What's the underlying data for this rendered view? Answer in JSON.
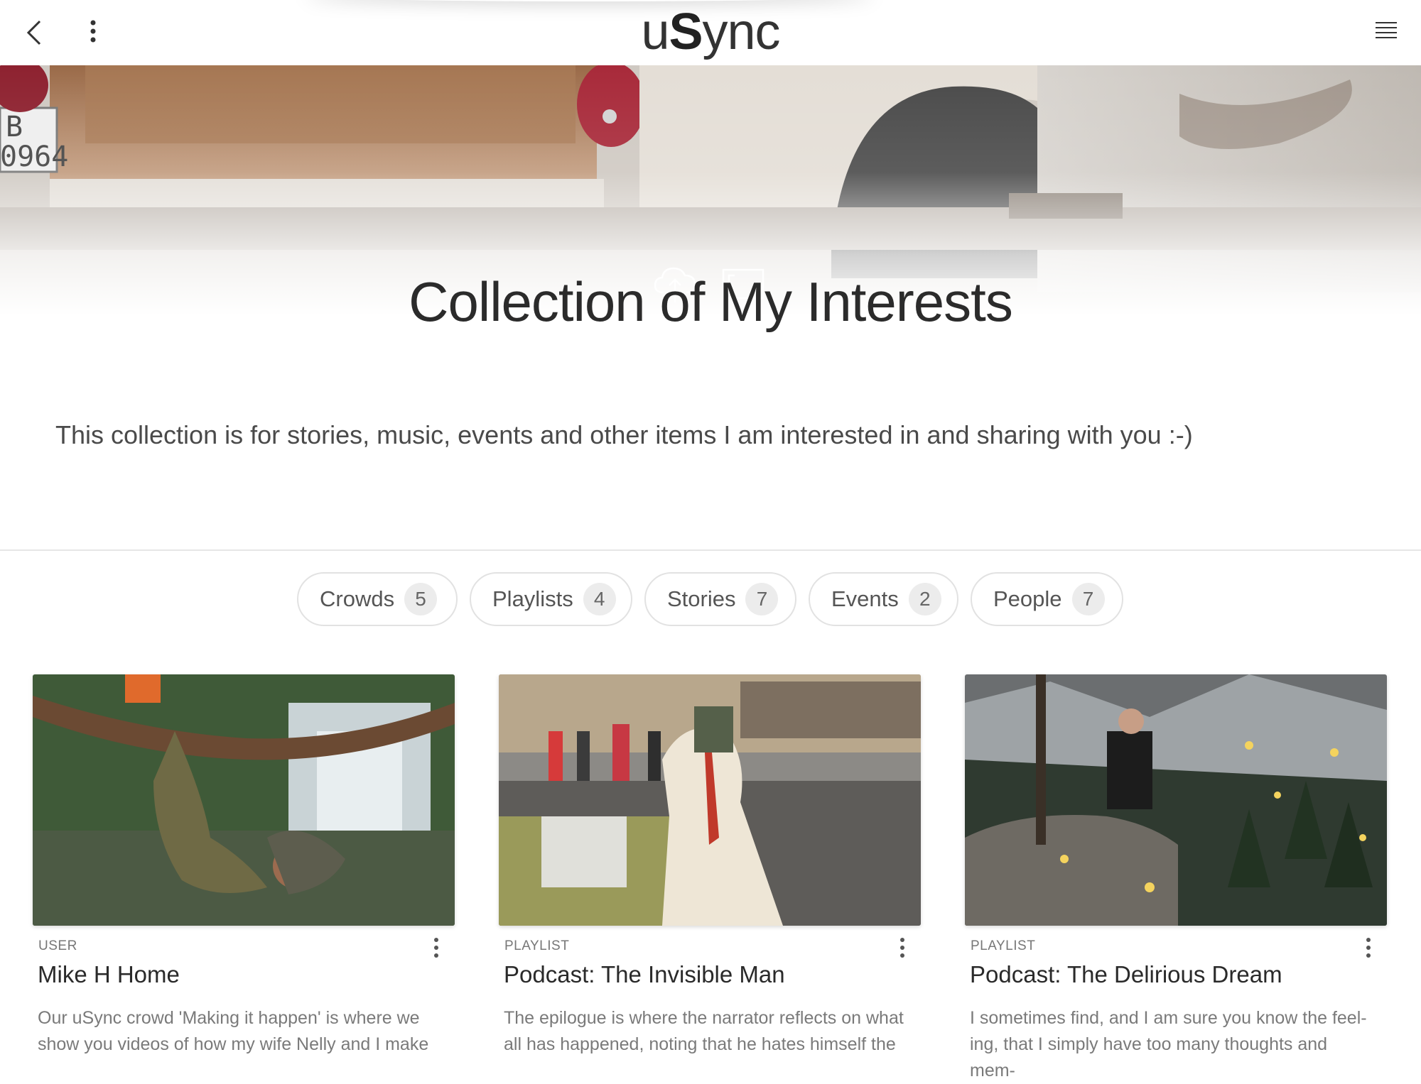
{
  "app": {
    "logo_prefix": "u",
    "logo_bold": "S",
    "logo_suffix": "ync"
  },
  "header_icons": [
    "back-arrow-icon",
    "more-vertical-icon",
    "hamburger-menu-icon"
  ],
  "hero": {
    "title": "Collection of My Interests",
    "icons": [
      "upload-cloud-icon",
      "fullscreen-icon"
    ]
  },
  "description": "This collection is for stories, music, events and other items I am interested in and sharing with you :-)",
  "filters": [
    {
      "label": "Crowds",
      "count": "5"
    },
    {
      "label": "Playlists",
      "count": "4"
    },
    {
      "label": "Stories",
      "count": "7"
    },
    {
      "label": "Events",
      "count": "2"
    },
    {
      "label": "People",
      "count": "7"
    }
  ],
  "cards": [
    {
      "type": "USER",
      "title": "Mike H Home",
      "description": "Our uSync crowd  'Making it happen' is where we show you videos of how my wife Nelly and I make"
    },
    {
      "type": "PLAYLIST",
      "title": "Podcast: The Invisible Man",
      "description": "The epilogue is where the narrator reflects on what all has happened, noting that he hates himself the"
    },
    {
      "type": "PLAYLIST",
      "title": "Podcast: The Delirious Dream",
      "description": " I sometimes find, and I am sure you know the feel-ing, that I simply have too many thoughts and mem-"
    }
  ],
  "colors": {
    "background": "#ffffff",
    "text": "#2a2a2a",
    "muted": "#7a7a7a",
    "pill_border": "#e2e2e2",
    "count_bg": "#ececec"
  }
}
